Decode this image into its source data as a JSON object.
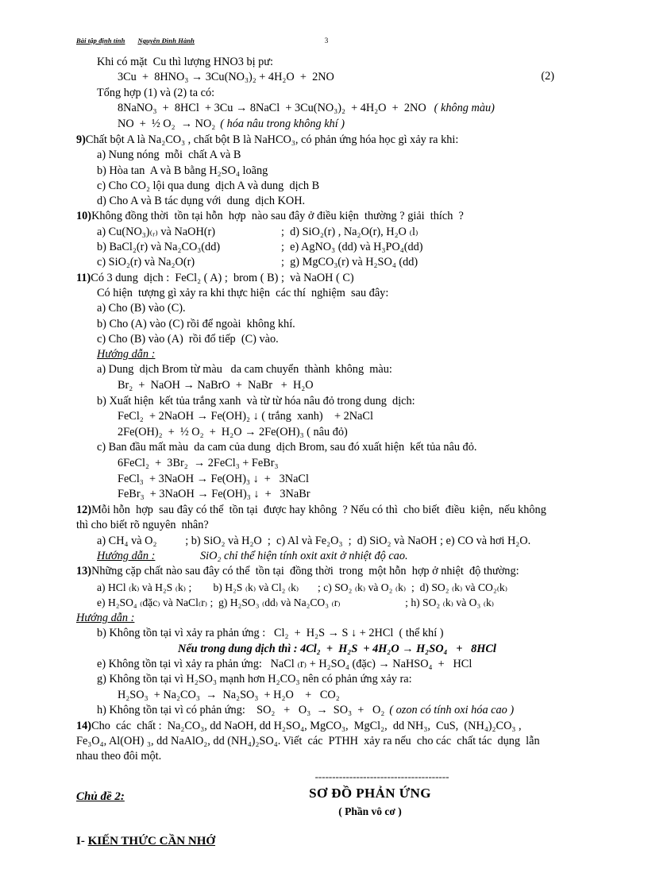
{
  "header": {
    "left": "Bài tập định tính",
    "author": "Nguyễn Đình Hành",
    "page_number": "3"
  },
  "body": {
    "intro": {
      "line1": "Khi có mặt  Cu thì lượng HNO3 bị pư:",
      "eq1_pre": "3Cu  +  8HNO",
      "eq1": "3Cu  +  8HNO₃ → 3Cu(NO₃)₂ + 4H₂O  +  2NO",
      "eq1_tag": "(2)",
      "line2": "Tổng hợp (1) và (2) ta có:",
      "eq2": "8NaNO₃  +  8HCl  + 3Cu → 8NaCl  + 3Cu(NO₃)₂  + 4H₂O  +  2NO",
      "eq2_note": "( không màu)",
      "eq3": "NO  +  ½ O₂  → NO₂",
      "eq3_note": "( hóa nâu trong không khí )"
    },
    "q9": {
      "num": "9)",
      "stem": "Chất bột A là Na₂CO₃ , chất bột B là NaHCO₃, có phản ứng hóa học gì xảy ra khi:",
      "options": [
        "a) Nung nóng  mỗi  chất A và B",
        "b) Hòa tan  A và B bằng H₂SO₄ loãng",
        "c) Cho CO₂ lội qua dung  dịch A và dung  dịch B",
        "d) Cho A và B tác dụng với  dung  dịch KOH."
      ]
    },
    "q10": {
      "num": "10)",
      "stem": "Không đồng thời  tồn tại hỗn  hợp  nào sau đây ở điều kiện  thường ? giải  thích  ?",
      "rows": [
        {
          "left": "a) Cu(NO₃)₍ᵣ₎ và NaOH(r)",
          "right": ";  d) SiO₂(r) , Na₂O(r), H₂O ₍l₎"
        },
        {
          "left": "b) BaCl₂(r) và Na₂CO₃(dd)",
          "right": ";  e) AgNO₃ (dd) và H₃PO₄(dd)"
        },
        {
          "left": "c) SiO₂(r) và Na₂O(r)",
          "right": ";  g) MgCO₃(r) và H₂SO₄ (dd)"
        }
      ]
    },
    "q11": {
      "num": "11)",
      "stem": "Có 3 dung  dịch :  FeCl₂ ( A) ;  brom ( B) ;  và NaOH ( C)",
      "line2": "Có hiện  tượng gì xảy ra khi thực hiện  các thí  nghiệm  sau đây:",
      "options": [
        "a) Cho (B) vào (C).",
        "b) Cho (A) vào (C) rồi để ngoài  không khí.",
        "c) Cho (B) vào (A)  rồi đổ tiếp  (C) vào."
      ],
      "huongdan_label": "Hướng dẫn :",
      "ans_a": "a) Dung  dịch Brom từ màu   da cam chuyển  thành  không  màu:",
      "ans_a_eq": "Br₂  +  NaOH → NaBrO  +  NaBr   +  H₂O",
      "ans_b": "b) Xuất hiện  kết tủa trắng xanh  và từ từ hóa nâu đỏ trong dung  dịch:",
      "ans_b_eq1": "FeCl₂  + 2NaOH → Fe(OH)₂ ↓ ( trắng  xanh)    + 2NaCl",
      "ans_b_eq2": "2Fe(OH)₂  +  ½ O₂  +  H₂O → 2Fe(OH)₃ ( nâu đỏ)",
      "ans_c": "c) Ban đầu mất màu  da cam của dung  dịch Brom, sau đó xuất hiện  kết tủa nâu đỏ.",
      "ans_c_eq1": "6FeCl₂  +  3Br₂  → 2FeCl₃ + FeBr₃",
      "ans_c_eq2": "FeCl₃  + 3NaOH → Fe(OH)₃ ↓  +   3NaCl",
      "ans_c_eq3": "FeBr₃  + 3NaOH → Fe(OH)₃ ↓  +   3NaBr"
    },
    "q12": {
      "num": "12)",
      "stem_l1": "Mỗi hỗn  hợp  sau đây có thể  tồn tại  được hay không  ? Nếu có thì  cho biết  điều  kiện,  nếu không",
      "stem_l2": "thì cho biết rõ nguyên  nhân?",
      "options": "a) CH₄ và O₂          ; b) SiO₂ và H₂O  ;  c) Al và Fe₂O₃  ;  d) SiO₂ và NaOH ; e) CO và hơi H₂O.",
      "huongdan_label": "Hướng dẫn :",
      "huongdan_text": "SiO₂ chỉ thể hiện tính oxit axit ở nhiệt độ cao."
    },
    "q13": {
      "num": "13)",
      "stem": "Những cặp chất nào sau đây có thể  tồn tại  đồng thời  trong  một hỗn  hợp ở nhiệt  độ thường:",
      "row1": "a) HCl ₍k₎ và H₂S ₍k₎ ;        b) H₂S ₍k₎ và Cl₂ ₍k₎       ; c) SO₂ ₍k₎ và O₂ ₍k₎  ;  d) SO₂ ₍k₎ và CO₂₍k₎",
      "row2": "e) H₂SO₄ ₍đặc₎ và NaCl₍r₎ ;  g) H₂SO₃ ₍dd₎ và Na₂CO₃ ₍r₎                        ; h) SO₂ ₍k₎ và O₃ ₍k₎",
      "huongdan_label": "Hướng dẫn :",
      "ans_b": "b) Không tồn tại vì xảy ra phản ứng :   Cl₂  +  H₂S → S ↓ + 2HCl  ( thể khí )",
      "ans_b_note": "Nếu trong dung dịch thì : 4Cl₂  +  H₂S  + 4H₂O → H₂SO₄   +   8HCl",
      "ans_e": "e) Không tồn tại vì xảy ra phản ứng:   NaCl ₍r₎ + H₂SO₄ (đặc) → NaHSO₄  +   HCl",
      "ans_g": "g) Không tồn tại vì H₂SO₃ mạnh hơn H₂CO₃ nên có phản ứng xảy ra:",
      "ans_g_eq": "H₂SO₃  + Na₂CO₃  →  Na₂SO₃  + H₂O    +   CO₂",
      "ans_h": "h) Không tồn tại vì có phản ứng:    SO₂   +   O₃  →  SO₃  +   O₂",
      "ans_h_note": "( ozon có tính oxi hóa cao )"
    },
    "q14": {
      "num": "14)",
      "l1": "Cho  các  chất :  Na₂CO₃, dd NaOH, dd H₂SO₄, MgCO₃,  MgCl₂,  dd NH₃,  CuS,  (NH₄)₂CO₃ ,",
      "l2": "Fe₃O₄, Al(OH) ₃, dd NaAlO₂, dd (NH₄)₂SO₄. Viết  các  PTHH  xảy ra nếu  cho các  chất tác  dụng  lẫn",
      "l3": "nhau theo đôi một."
    }
  },
  "footer": {
    "divider": "---------------------------------------",
    "chude": "Chủ đề 2:",
    "title": "SƠ ĐỒ PHẢN ỨNG",
    "subtitle": "( Phần vô cơ )",
    "section_prefix": "I- ",
    "section_label": "KIẾN THỨC CẦN NHỚ"
  }
}
